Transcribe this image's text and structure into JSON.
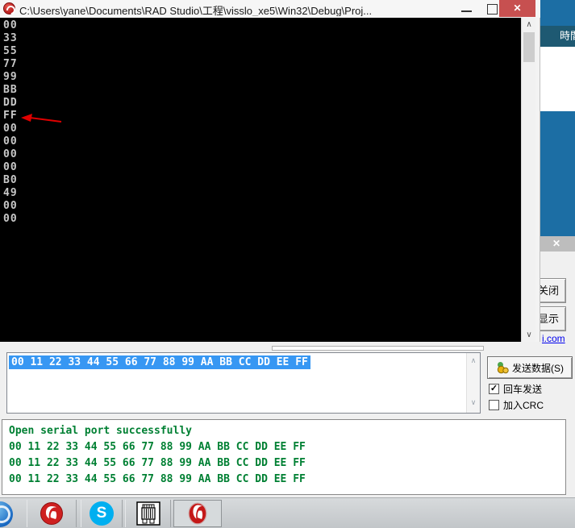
{
  "console_window": {
    "title": "C:\\Users\\yane\\Documents\\RAD Studio\\工程\\visslo_xe5\\Win32\\Debug\\Proj...",
    "lines": [
      "00",
      "33",
      "55",
      "77",
      "99",
      "BB",
      "DD",
      "FF",
      "00",
      "00",
      "00",
      "00",
      "B0",
      "49",
      "00",
      "00"
    ],
    "arrow_points_to": "FF"
  },
  "background_window": {
    "header_label": "時間",
    "close_glyph": "✕",
    "close_button_label": "关闭",
    "show_button_label": "显示",
    "link_text": "i.com"
  },
  "send_panel": {
    "input_text": "00 11 22 33 44 55 66 77 88 99 AA BB CC DD EE FF",
    "send_button_label": "发送数据(S)",
    "enter_checkbox": {
      "label": "回车发送",
      "checked": true
    },
    "crc_checkbox": {
      "label": "加入CRC",
      "checked": false
    }
  },
  "output_panel": {
    "lines": [
      "Open serial port successfully",
      "00 11 22 33 44 55 66 77 88 99 AA BB CC DD EE FF",
      "00 11 22 33 44 55 66 77 88 99 AA BB CC DD EE FF",
      "00 11 22 33 44 55 66 77 88 99 AA BB CC DD EE FF"
    ]
  },
  "taskbar": {
    "skype_letter": "S",
    "icons": [
      "ie-orb-icon",
      "delphi-icon",
      "skype-icon",
      "serial-port-icon",
      "delphi-app-icon"
    ]
  },
  "icons": {
    "close_glyph": "✕",
    "check_glyph": "✓",
    "caret_up": "∧",
    "caret_down": "∨"
  },
  "colors": {
    "close_button_red": "#C75050",
    "selection_blue": "#3797F3",
    "output_green": "#008033",
    "bg_window_blue": "#1C6EA4",
    "bg_window_header": "#1E5972",
    "console_text": "#C8C8C8",
    "arrow_red": "#E00000"
  }
}
